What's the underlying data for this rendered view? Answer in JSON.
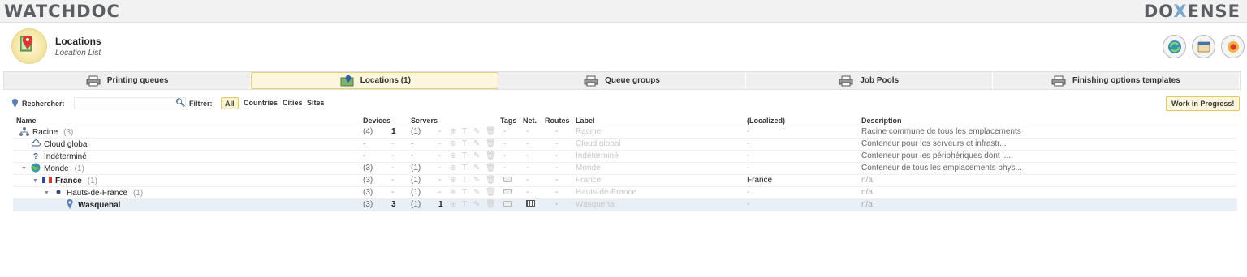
{
  "branding": {
    "left_logo": "WATCHDOC",
    "right_logo_a": "DO",
    "right_logo_b": "X",
    "right_logo_c": "ENSE"
  },
  "header": {
    "title": "Locations",
    "subtitle": "Location List"
  },
  "tabs": [
    {
      "label": "Printing queues",
      "icon": "printer-icon"
    },
    {
      "label": "Locations (1)",
      "icon": "map-icon",
      "active": true
    },
    {
      "label": "Queue groups",
      "icon": "printer-group-icon"
    },
    {
      "label": "Job Pools",
      "icon": "printer-pool-icon"
    },
    {
      "label": "Finishing options templates",
      "icon": "printer-finishing-icon"
    }
  ],
  "toolbar": {
    "search_label": "Rechercher:",
    "search_value": "",
    "filter_label": "Filtrer:",
    "filters": [
      "All",
      "Countries",
      "Cities",
      "Sites"
    ],
    "active_filter": "All",
    "wip_label": "Work in Progress!"
  },
  "columns": {
    "name": "Name",
    "devices": "Devices",
    "servers": "Servers",
    "tags": "Tags",
    "net": "Net.",
    "routes": "Routes",
    "label": "Label",
    "localized": "(Localized)",
    "description": "Description"
  },
  "rows": [
    {
      "name": "Racine",
      "count": "(3)",
      "devices": "(4)",
      "devices2": "1",
      "servers": "(1)",
      "servers2": "-",
      "tags": "-",
      "net": "-",
      "routes": "-",
      "label": "Racine",
      "localized": "-",
      "description": "Racine commune de tous les emplacements",
      "icon": "network-icon",
      "indent": 0
    },
    {
      "name": "Cloud global",
      "count": "",
      "devices": "-",
      "devices2": "-",
      "servers": "-",
      "servers2": "-",
      "tags": "-",
      "net": "-",
      "routes": "-",
      "label": "Cloud global",
      "localized": "-",
      "description": "Conteneur pour les serveurs et infrastr...",
      "icon": "cloud-icon",
      "indent": 1
    },
    {
      "name": "Indéterminé",
      "count": "",
      "devices": "-",
      "devices2": "-",
      "servers": "-",
      "servers2": "-",
      "tags": "-",
      "net": "-",
      "routes": "-",
      "label": "Indéterminé",
      "localized": "-",
      "description": "Conteneur pour les périphériques dont l...",
      "icon": "question-icon",
      "indent": 1
    },
    {
      "name": "Monde",
      "count": "(1)",
      "devices": "(3)",
      "devices2": "-",
      "servers": "(1)",
      "servers2": "-",
      "tags": "-",
      "net": "-",
      "routes": "-",
      "label": "Monde",
      "localized": "-",
      "description": "Conteneur de tous les emplacements phys...",
      "icon": "globe-icon",
      "indent": 1,
      "toggle": "▼"
    },
    {
      "name": "France",
      "count": "(1)",
      "devices": "(3)",
      "devices2": "-",
      "servers": "(1)",
      "servers2": "-",
      "tags": "tag",
      "net": "-",
      "routes": "-",
      "label": "France",
      "localized": "France",
      "description": "n/a",
      "icon": "flag-france-icon",
      "indent": 2,
      "toggle": "▼",
      "bold": true
    },
    {
      "name": "Hauts-de-France",
      "count": "(1)",
      "devices": "(3)",
      "devices2": "-",
      "servers": "(1)",
      "servers2": "-",
      "tags": "tag",
      "net": "-",
      "routes": "-",
      "label": "Hauts-de-France",
      "localized": "-",
      "description": "n/a",
      "icon": "dot-icon",
      "indent": 3,
      "toggle": "▼"
    },
    {
      "name": "Wasquehal",
      "count": "",
      "devices": "(3)",
      "devices2": "3",
      "servers": "(1)",
      "servers2": "1",
      "tags": "tag",
      "net": "net",
      "routes": "-",
      "label": "Wasquehal",
      "localized": "-",
      "description": "n/a",
      "icon": "pin-icon",
      "indent": 4,
      "bold": true,
      "selected": true
    }
  ]
}
